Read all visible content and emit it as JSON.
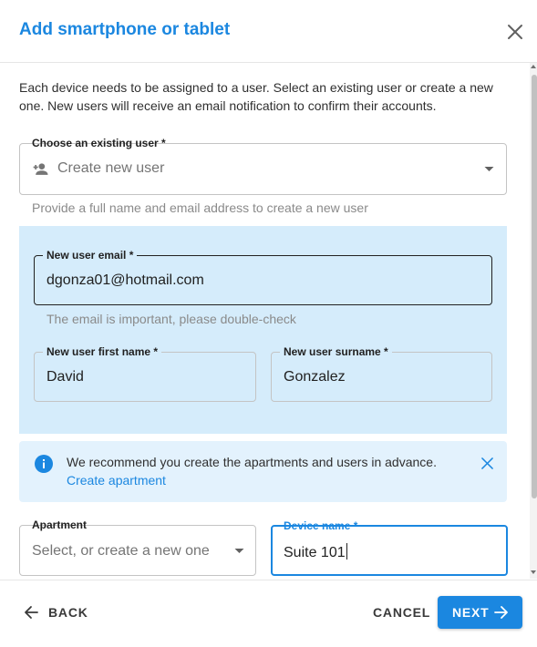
{
  "dialog": {
    "title": "Add smartphone or tablet",
    "intro": "Each device needs to be assigned to a user. Select an existing user or create a new one. New users will receive an email notification to confirm their accounts."
  },
  "user_select": {
    "label": "Choose an existing user *",
    "value": "Create new user",
    "helper": "Provide a full name and email address to create a new user",
    "icon": "person-add-icon"
  },
  "new_user": {
    "email_label": "New user email *",
    "email_value": "dgonza01@hotmail.com",
    "email_helper": "The email is important, please double-check",
    "first_name_label": "New user first name *",
    "first_name_value": "David",
    "surname_label": "New user surname *",
    "surname_value": "Gonzalez"
  },
  "info": {
    "text": "We recommend you create the apartments and users in advance.",
    "link": "Create apartment"
  },
  "apartment": {
    "label": "Apartment",
    "placeholder": "Select, or create a new one"
  },
  "device_name": {
    "label": "Device name *",
    "value": "Suite 101"
  },
  "footer": {
    "back_label": "BACK",
    "cancel_label": "CANCEL",
    "next_label": "NEXT"
  },
  "colors": {
    "accent": "#1b87e0",
    "panel_bg": "#d5ecfb",
    "info_bg": "#e3f2fd"
  }
}
